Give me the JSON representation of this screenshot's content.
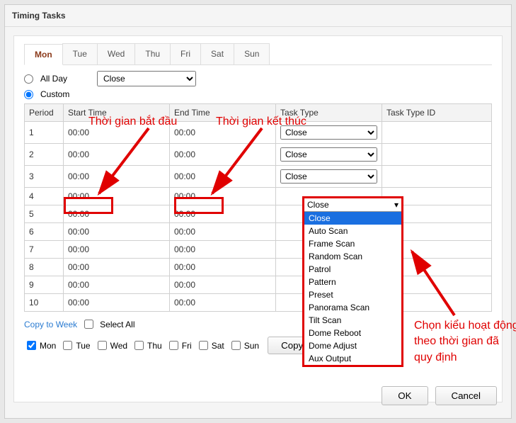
{
  "window": {
    "title": "Timing Tasks"
  },
  "tabs": [
    "Mon",
    "Tue",
    "Wed",
    "Thu",
    "Fri",
    "Sat",
    "Sun"
  ],
  "active_tab": 0,
  "mode": {
    "allday_label": "All Day",
    "custom_label": "Custom",
    "allday_checked": false,
    "custom_checked": true,
    "allday_select_value": "Close"
  },
  "annotations": {
    "start_label": "Thời gian bắt đầu",
    "end_label": "Thời gian kết thúc",
    "right_text": "Chọn kiểu hoạt động theo thời gian đã quy định"
  },
  "headers": {
    "period": "Period",
    "start": "Start Time",
    "end": "End Time",
    "task": "Task Type",
    "taskid": "Task Type ID"
  },
  "rows": [
    {
      "period": "1",
      "start": "00:00",
      "end": "00:00",
      "task": "Close",
      "taskid": ""
    },
    {
      "period": "2",
      "start": "00:00",
      "end": "00:00",
      "task": "Close",
      "taskid": ""
    },
    {
      "period": "3",
      "start": "00:00",
      "end": "00:00",
      "task": "Close",
      "taskid": ""
    },
    {
      "period": "4",
      "start": "00:00",
      "end": "00:00",
      "task": "",
      "taskid": ""
    },
    {
      "period": "5",
      "start": "00:00",
      "end": "00:00",
      "task": "",
      "taskid": ""
    },
    {
      "period": "6",
      "start": "00:00",
      "end": "00:00",
      "task": "",
      "taskid": ""
    },
    {
      "period": "7",
      "start": "00:00",
      "end": "00:00",
      "task": "",
      "taskid": ""
    },
    {
      "period": "8",
      "start": "00:00",
      "end": "00:00",
      "task": "",
      "taskid": ""
    },
    {
      "period": "9",
      "start": "00:00",
      "end": "00:00",
      "task": "",
      "taskid": ""
    },
    {
      "period": "10",
      "start": "00:00",
      "end": "00:00",
      "task": "",
      "taskid": ""
    }
  ],
  "dropdown": {
    "selected": "Close",
    "options": [
      "Close",
      "Auto Scan",
      "Frame Scan",
      "Random Scan",
      "Patrol",
      "Pattern",
      "Preset",
      "Panorama Scan",
      "Tilt Scan",
      "Dome Reboot",
      "Dome Adjust",
      "Aux Output"
    ]
  },
  "copy": {
    "link": "Copy to Week",
    "select_all": "Select All",
    "days": [
      "Mon",
      "Tue",
      "Wed",
      "Thu",
      "Fri",
      "Sat",
      "Sun"
    ],
    "checked_first": true,
    "button": "Copy"
  },
  "buttons": {
    "ok": "OK",
    "cancel": "Cancel"
  }
}
